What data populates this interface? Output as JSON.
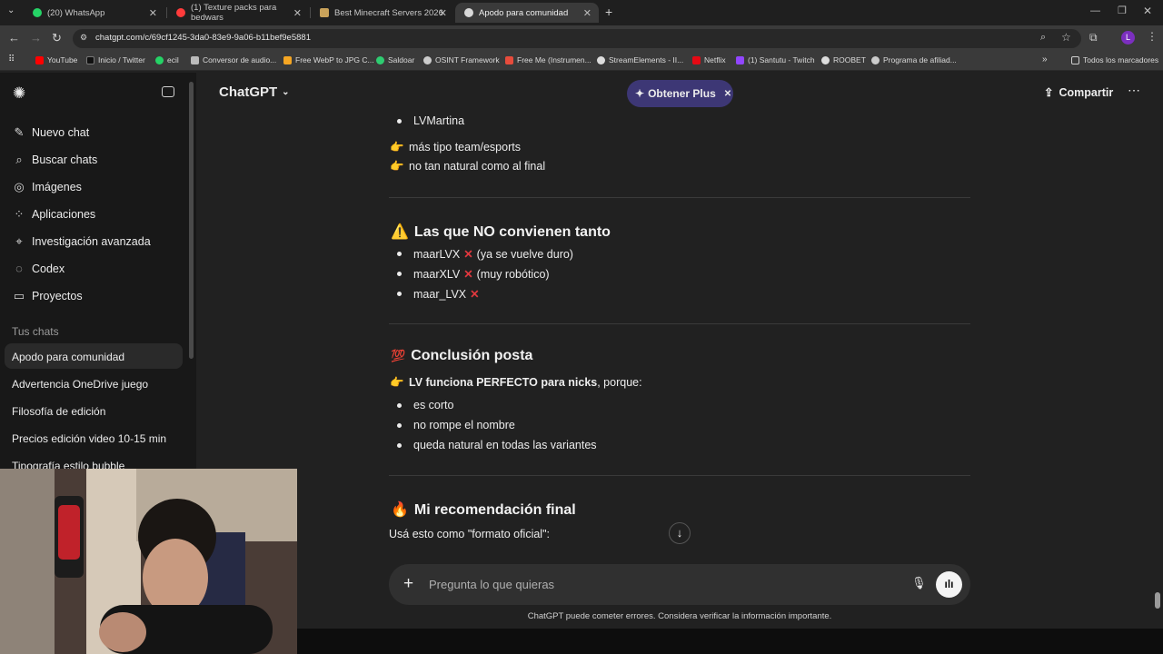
{
  "browser": {
    "tabs": [
      {
        "label": "(20) WhatsApp",
        "color": "#25d366"
      },
      {
        "label": "(1) Texture packs para bedwars",
        "color": "#ff3b3b"
      },
      {
        "label": "Best Minecraft Servers 2026",
        "color": "#c9a25a"
      },
      {
        "label": "Apodo para comunidad",
        "color": "#d9d9d9"
      }
    ],
    "url": "chatgpt.com/c/69cf1245-3da0-83e9-9a06-b11bef9e5881",
    "bookmarks": [
      {
        "label": "YouTube",
        "color": "#ff0000"
      },
      {
        "label": "Inicio / Twitter",
        "color": "#111111"
      },
      {
        "label": "ecil",
        "color": "#25d366"
      },
      {
        "label": "Conversor de audio...",
        "color": "#bbbbbb"
      },
      {
        "label": "Free WebP to JPG C...",
        "color": "#f5a623"
      },
      {
        "label": "Saldoar",
        "color": "#2ecc71"
      },
      {
        "label": "OSINT Framework",
        "color": "#cccccc"
      },
      {
        "label": "Free Me (Instrumen...",
        "color": "#e74c3c"
      },
      {
        "label": "StreamElements - II...",
        "color": "#dddddd"
      },
      {
        "label": "Netflix",
        "color": "#e50914"
      },
      {
        "label": "(1) Santutu - Twitch",
        "color": "#9146ff"
      },
      {
        "label": "ROOBET",
        "color": "#dddddd"
      },
      {
        "label": "Programa de afiliad...",
        "color": "#cccccc"
      }
    ],
    "all_bookmarks": "Todos los marcadores",
    "profile_initial": "L"
  },
  "sidebar": {
    "nav": [
      {
        "label": "Nuevo chat",
        "icon": "edit-icon"
      },
      {
        "label": "Buscar chats",
        "icon": "search-icon"
      },
      {
        "label": "Imágenes",
        "icon": "image-icon"
      },
      {
        "label": "Aplicaciones",
        "icon": "apps-icon"
      },
      {
        "label": "Investigación avanzada",
        "icon": "telescope-icon"
      },
      {
        "label": "Codex",
        "icon": "codex-icon"
      },
      {
        "label": "Proyectos",
        "icon": "folder-icon"
      }
    ],
    "section_title": "Tus chats",
    "chats": [
      "Apodo para comunidad",
      "Advertencia OneDrive juego",
      "Filosofía de edición",
      "Precios edición video 10-15 min",
      "Tipografía estilo bubble"
    ]
  },
  "header": {
    "model": "ChatGPT",
    "upgrade": "Obtener Plus",
    "share": "Compartir"
  },
  "content": {
    "top_bullet": "LVMartina",
    "note1": "más tipo team/esports",
    "note2": "no tan natural como al final",
    "section1_title": "Las que NO convienen tanto",
    "section1_items": [
      {
        "name": "maarLVX",
        "note": "(ya se vuelve duro)"
      },
      {
        "name": "maarXLV",
        "note": "(muy robótico)"
      },
      {
        "name": "maar_LVX",
        "note": ""
      }
    ],
    "section2_title": "Conclusión posta",
    "section2_lead_bold": "LV funciona PERFECTO para nicks",
    "section2_lead_rest": ", porque:",
    "section2_items": [
      "es corto",
      "no rompe el nombre",
      "queda natural en todas las variantes"
    ],
    "section3_title": "Mi recomendación final",
    "section3_text": "Usá esto como \"formato oficial\":"
  },
  "composer": {
    "placeholder": "Pregunta lo que quieras"
  },
  "footer": "ChatGPT puede cometer errores. Considera verificar la información importante."
}
